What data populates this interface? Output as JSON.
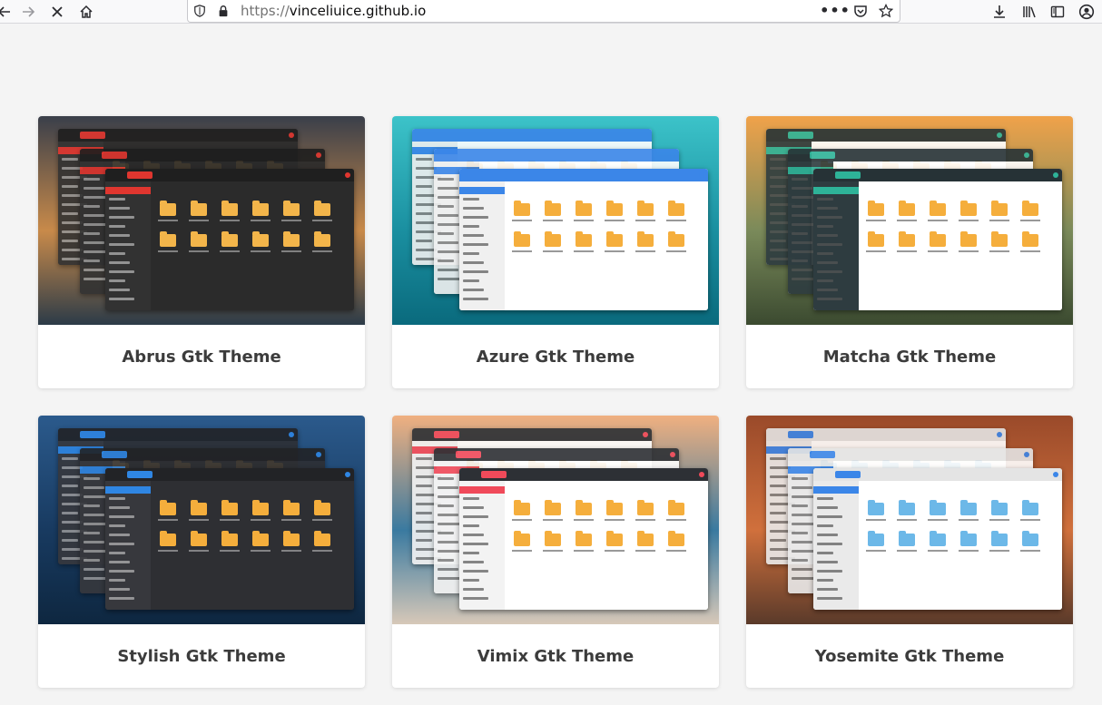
{
  "browser": {
    "url_protocol": "https://",
    "url_host": "vinceliuice.github.io",
    "icons": {
      "back": "back-arrow-icon",
      "forward": "forward-arrow-icon",
      "stop": "stop-loading-icon",
      "home": "home-icon",
      "shield": "tracking-shield-icon",
      "lock": "lock-icon",
      "more": "more-actions-icon",
      "pocket": "pocket-icon",
      "bookmark": "bookmark-star-icon",
      "download": "download-icon",
      "library": "library-icon",
      "sidebar": "sidebar-icon",
      "account": "account-icon"
    }
  },
  "themes": [
    {
      "title": "Abrus Gtk Theme",
      "bg_top": "#3a3f4a",
      "bg_mid": "#c88a4a",
      "bg_bot": "#2c3b48",
      "win": "#2b2b2b",
      "win_hb": "#1f1f1f",
      "accent": "#e0362f",
      "sidebar": "#323232",
      "folder": "#f3b54a",
      "text": "#bbbbbb"
    },
    {
      "title": "Azure Gtk Theme",
      "bg_top": "#3cc3c9",
      "bg_mid": "#1a8fa0",
      "bg_bot": "#0a6a7d",
      "win": "#ffffff",
      "win_hb": "#3b86e8",
      "accent": "#3b86e8",
      "sidebar": "#f0f0f0",
      "folder": "#f5ae3c",
      "text": "#555555"
    },
    {
      "title": "Matcha Gtk Theme",
      "bg_top": "#f0a24a",
      "bg_mid": "#7a8a5a",
      "bg_bot": "#3b4a30",
      "win": "#ffffff",
      "win_hb": "#263236",
      "accent": "#2eb398",
      "sidebar": "#2e3c40",
      "folder": "#f5ae3c",
      "text": "#555555"
    },
    {
      "title": "Stylish Gtk Theme",
      "bg_top": "#2b5a8c",
      "bg_mid": "#183a60",
      "bg_bot": "#0e2740",
      "win": "#2e2f33",
      "win_hb": "#222326",
      "accent": "#2f86e3",
      "sidebar": "#37383d",
      "folder": "#f5ae3c",
      "text": "#bbbbbb"
    },
    {
      "title": "Vimix Gtk Theme",
      "bg_top": "#f0b080",
      "bg_mid": "#3a7aa0",
      "bg_bot": "#d7c8b8",
      "win": "#ffffff",
      "win_hb": "#2d3035",
      "accent": "#f04a5a",
      "sidebar": "#f3f3f3",
      "folder": "#f5ae3c",
      "text": "#555555"
    },
    {
      "title": "Yosemite Gtk Theme",
      "bg_top": "#9a4a2a",
      "bg_mid": "#d0703c",
      "bg_bot": "#5a3a2a",
      "win": "#ffffff",
      "win_hb": "#e4e4e4",
      "accent": "#3b86e8",
      "sidebar": "#eaeaea",
      "folder": "#6cb8e8",
      "text": "#555555"
    }
  ]
}
